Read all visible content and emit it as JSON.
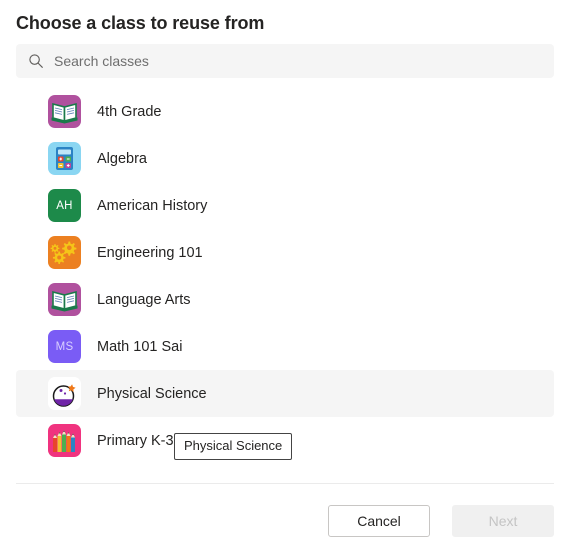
{
  "dialog": {
    "title": "Choose a class to reuse from"
  },
  "search": {
    "placeholder": "Search classes",
    "value": "",
    "icon": "search-icon"
  },
  "classes": [
    {
      "name": "4th Grade",
      "icon": "book-icon",
      "tile_color": "#b0519e",
      "initials": ""
    },
    {
      "name": "Algebra",
      "icon": "calculator-icon",
      "tile_color": "#8ad6f2",
      "initials": ""
    },
    {
      "name": "American History",
      "icon": "initials-tile",
      "tile_color": "#1d8a4a",
      "initials": "AH"
    },
    {
      "name": "Engineering 101",
      "icon": "gears-icon",
      "tile_color": "#ec8021",
      "initials": ""
    },
    {
      "name": "Language Arts",
      "icon": "book-icon",
      "tile_color": "#b0519e",
      "initials": ""
    },
    {
      "name": "Math 101 Sai",
      "icon": "initials-tile",
      "tile_color": "#7a5cf5",
      "initials": "MS"
    },
    {
      "name": "Physical Science",
      "icon": "flask-icon",
      "tile_color": "#ffffff",
      "initials": ""
    },
    {
      "name": "Primary K-3",
      "icon": "pencils-icon",
      "tile_color": "#f0337f",
      "initials": ""
    }
  ],
  "selected_class_index": 6,
  "tooltip": {
    "text": "Physical Science"
  },
  "footer": {
    "cancel_label": "Cancel",
    "next_label": "Next",
    "next_disabled": true
  },
  "colors": {
    "selected_row_bg": "#f5f5f5",
    "search_bg": "#f5f5f5",
    "text": "#252423",
    "placeholder": "#6e6e6e",
    "divider": "#ebebeb",
    "disabled_button_bg": "#f0f0f0",
    "disabled_button_text": "#c4c4c4"
  }
}
